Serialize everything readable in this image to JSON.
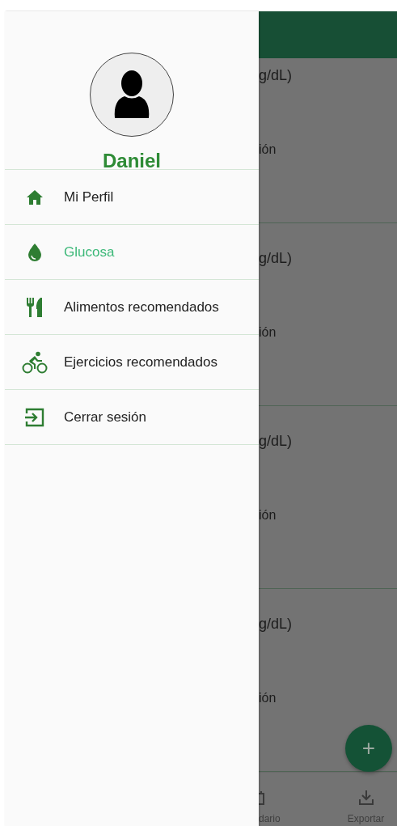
{
  "drawer": {
    "profile": {
      "name": "Daniel"
    },
    "items": [
      {
        "label": "Mi Perfil",
        "kind": "home",
        "selected": false
      },
      {
        "label": "Glucosa",
        "kind": "drop",
        "selected": true
      },
      {
        "label": "Alimentos recomendados",
        "kind": "food",
        "selected": false
      },
      {
        "label": "Ejercicios recomendados",
        "kind": "bike",
        "selected": false
      },
      {
        "label": "Cerrar sesión",
        "kind": "logout",
        "selected": false
      }
    ]
  },
  "background": {
    "cards": [
      {
        "line_1": "g/dL)",
        "line_2": "ión"
      },
      {
        "line_1": "g/dL)",
        "line_2": "ión"
      },
      {
        "line_1": "g/dL)",
        "line_2": "ión"
      },
      {
        "line_1": "g/dL)",
        "line_2": "ión"
      }
    ],
    "fab": "+",
    "bottom_nav": [
      {
        "label": "dario",
        "kind": "calendar"
      },
      {
        "label": "Exportar",
        "kind": "download"
      }
    ]
  }
}
